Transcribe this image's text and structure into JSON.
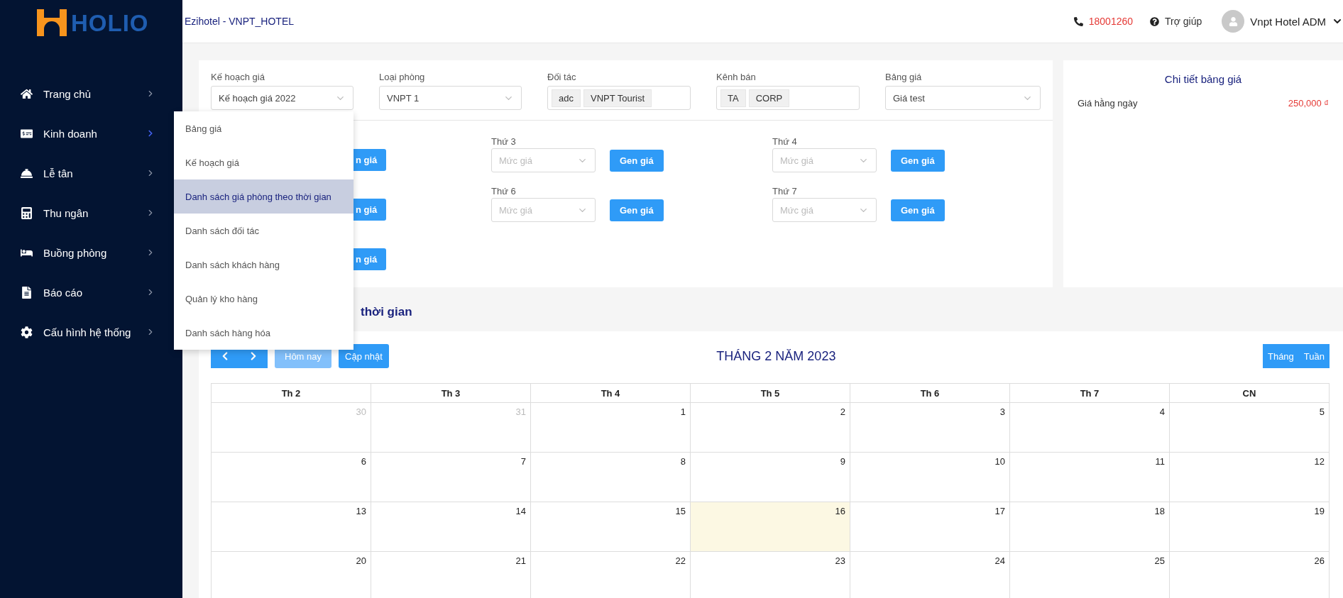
{
  "logo": {
    "text": "HOLIO"
  },
  "topbar": {
    "title": "Ezihotel - VNPT_HOTEL",
    "phone": "18001260",
    "help": "Trợ giúp",
    "user": "Vnpt Hotel ADM"
  },
  "sidebar": {
    "items": [
      {
        "label": "Trang chủ",
        "selected": false
      },
      {
        "label": "Kinh doanh",
        "selected": true
      },
      {
        "label": "Lễ tân",
        "selected": false
      },
      {
        "label": "Thu ngân",
        "selected": false
      },
      {
        "label": "Buồng phòng",
        "selected": false
      },
      {
        "label": "Báo cáo",
        "selected": false
      },
      {
        "label": "Cấu hình hệ thống",
        "selected": false
      }
    ]
  },
  "submenu": {
    "items": [
      {
        "label": "Bảng giá",
        "selected": false
      },
      {
        "label": "Kế hoạch giá",
        "selected": false
      },
      {
        "label": "Danh sách giá phòng theo thời gian",
        "selected": true
      },
      {
        "label": "Danh sách đối tác",
        "selected": false
      },
      {
        "label": "Danh sách khách hàng",
        "selected": false
      },
      {
        "label": "Quản lý kho hàng",
        "selected": false
      },
      {
        "label": "Danh sách hàng hóa",
        "selected": false
      }
    ]
  },
  "filters": [
    {
      "label": "Kế hoạch giá",
      "kind": "select",
      "value": "Kế hoạch giá 2022"
    },
    {
      "label": "Loại phòng",
      "kind": "select",
      "value": "VNPT 1"
    },
    {
      "label": "Đối tác",
      "kind": "tags",
      "tags": [
        "adc",
        "VNPT Tourist"
      ]
    },
    {
      "label": "Kênh bán",
      "kind": "tags",
      "tags": [
        "TA",
        "CORP"
      ]
    },
    {
      "label": "Bảng giá",
      "kind": "select",
      "value": "Giá test"
    }
  ],
  "price_rows": [
    [
      {
        "kind": "button",
        "button": "n giá"
      },
      {
        "kind": "day",
        "label": "Thứ 3",
        "placeholder": "Mức giá",
        "button": "Gen giá"
      },
      {
        "kind": "day",
        "label": "Thứ 4",
        "placeholder": "Mức giá",
        "button": "Gen giá"
      }
    ],
    [
      {
        "kind": "button",
        "button": "n giá"
      },
      {
        "kind": "day",
        "label": "Thứ 6",
        "placeholder": "Mức giá",
        "button": "Gen giá"
      },
      {
        "kind": "day",
        "label": "Thứ 7",
        "placeholder": "Mức giá",
        "button": "Gen giá"
      }
    ],
    [
      {
        "kind": "button",
        "button": "n giá"
      }
    ]
  ],
  "detail": {
    "title": "Chi tiết bảng giá",
    "rows": [
      {
        "label": "Giá hằng ngày",
        "value": "250,000 ₫"
      }
    ]
  },
  "section_title": "thời gian",
  "calendar": {
    "today": {
      "label": "Hôm nay",
      "disabled": true
    },
    "update": "Cập nhật",
    "title": "THÁNG 2 NĂM 2023",
    "views": [
      "Tháng",
      "Tuần"
    ],
    "weekdays": [
      "Th 2",
      "Th 3",
      "Th 4",
      "Th 5",
      "Th 6",
      "Th 7",
      "CN"
    ],
    "weeks": [
      [
        {
          "day": "30",
          "muted": true,
          "selected": false
        },
        {
          "day": "31",
          "muted": true,
          "selected": false
        },
        {
          "day": "1",
          "muted": false,
          "selected": false
        },
        {
          "day": "2",
          "muted": false,
          "selected": false
        },
        {
          "day": "3",
          "muted": false,
          "selected": false
        },
        {
          "day": "4",
          "muted": false,
          "selected": false
        },
        {
          "day": "5",
          "muted": false,
          "selected": false
        }
      ],
      [
        {
          "day": "6",
          "muted": false,
          "selected": false
        },
        {
          "day": "7",
          "muted": false,
          "selected": false
        },
        {
          "day": "8",
          "muted": false,
          "selected": false
        },
        {
          "day": "9",
          "muted": false,
          "selected": false
        },
        {
          "day": "10",
          "muted": false,
          "selected": false
        },
        {
          "day": "11",
          "muted": false,
          "selected": false
        },
        {
          "day": "12",
          "muted": false,
          "selected": false
        }
      ],
      [
        {
          "day": "13",
          "muted": false,
          "selected": false
        },
        {
          "day": "14",
          "muted": false,
          "selected": false
        },
        {
          "day": "15",
          "muted": false,
          "selected": false
        },
        {
          "day": "16",
          "muted": false,
          "selected": true
        },
        {
          "day": "17",
          "muted": false,
          "selected": false
        },
        {
          "day": "18",
          "muted": false,
          "selected": false
        },
        {
          "day": "19",
          "muted": false,
          "selected": false
        }
      ],
      [
        {
          "day": "20",
          "muted": false,
          "selected": false
        },
        {
          "day": "21",
          "muted": false,
          "selected": false
        },
        {
          "day": "22",
          "muted": false,
          "selected": false
        },
        {
          "day": "23",
          "muted": false,
          "selected": false
        },
        {
          "day": "24",
          "muted": false,
          "selected": false
        },
        {
          "day": "25",
          "muted": false,
          "selected": false
        },
        {
          "day": "26",
          "muted": false,
          "selected": false
        }
      ]
    ]
  }
}
